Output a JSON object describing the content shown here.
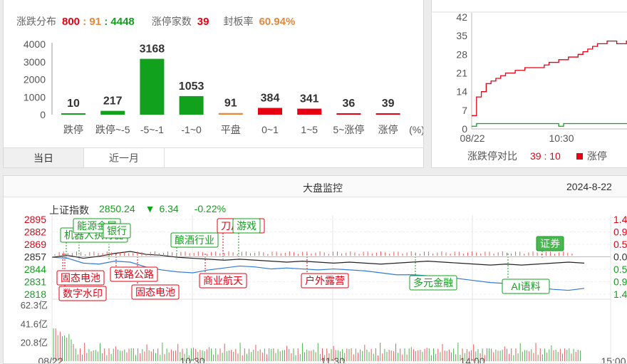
{
  "distribution": {
    "label": "涨跌分布",
    "up": "800",
    "sep1": ":",
    "flat": "91",
    "sep2": ":",
    "down": "4448",
    "limit_up_label": "涨停家数",
    "limit_up_count": "39",
    "seal_rate_label": "封板率",
    "seal_rate": "60.94%",
    "unit": "(%)",
    "tabs": [
      {
        "label": "当日"
      },
      {
        "label": "近一月"
      }
    ]
  },
  "ratio": {
    "label": "涨跌停对比",
    "value": "39 : 10",
    "legend_label": "涨停"
  },
  "monitor": {
    "title": "大盘监控",
    "date": "2024-8-22",
    "index_name": "上证指数",
    "index_value": "2850.24",
    "arrow": "▼",
    "change": "6.34",
    "pct": "-0.22%",
    "events": [
      {
        "text": "机器人执行器",
        "color": "green",
        "t": 10
      },
      {
        "text": "能源金属",
        "color": "green",
        "t": 18
      },
      {
        "text": "银行",
        "color": "green",
        "t": 30
      },
      {
        "text": "固态电池",
        "color": "red",
        "t": 8
      },
      {
        "text": "数字水印",
        "color": "red",
        "t": 4
      },
      {
        "text": "铁路公路",
        "color": "red",
        "t": 36
      },
      {
        "text": "固态电池",
        "color": "red",
        "t": 48
      },
      {
        "text": "酿酒行业",
        "color": "green",
        "t": 68
      },
      {
        "text": "商业航天",
        "color": "red",
        "t": 70
      },
      {
        "text": "刀片电池",
        "color": "red",
        "t": 80
      },
      {
        "text": "游戏",
        "color": "green",
        "t": 86
      },
      {
        "text": "户外露营",
        "color": "red",
        "t": 119
      },
      {
        "text": "多元金融",
        "color": "green",
        "t": 170
      },
      {
        "text": "AI语料",
        "color": "green",
        "t": 204
      },
      {
        "text": "证券",
        "color": "green",
        "t": 210
      }
    ]
  },
  "chart_data": [
    {
      "type": "bar",
      "categories": [
        "跌停",
        "跌停~-5",
        "-5~-1",
        "-1~0",
        "平盘",
        "0~1",
        "1~5",
        "5~涨停",
        "涨停"
      ],
      "values": [
        10,
        217,
        3168,
        1053,
        91,
        384,
        341,
        36,
        39
      ],
      "colors": [
        "#11a11c",
        "#11a11c",
        "#11a11c",
        "#11a11c",
        "#e8873a",
        "#e60012",
        "#e60012",
        "#e60012",
        "#e60012"
      ],
      "ylim": [
        0,
        4000
      ],
      "yticks": [
        "4000",
        "3000",
        "2000",
        "1000",
        "0"
      ]
    },
    {
      "type": "line",
      "x_start": "08/22",
      "x_ticks": [
        "08/22",
        "10:30"
      ],
      "yticks": [
        "42",
        "35",
        "28",
        "21",
        "14",
        "7",
        "0"
      ],
      "ylim": [
        0,
        42
      ],
      "series": [
        {
          "name": "涨停",
          "color": "#e60012",
          "values": [
            5,
            12,
            14,
            17,
            18,
            19,
            20,
            21,
            21,
            22,
            22,
            23,
            23,
            23,
            23,
            24,
            25,
            25,
            26,
            26,
            27,
            27,
            28,
            29,
            30,
            31,
            32,
            32,
            33,
            33,
            32,
            32,
            33,
            32
          ]
        },
        {
          "name": "跌停",
          "color": "#11a11c",
          "values": [
            1,
            2,
            2,
            2,
            2,
            2,
            2,
            2,
            2,
            2,
            2,
            2,
            2,
            2,
            2,
            2,
            2,
            2,
            1,
            2,
            2,
            2,
            2,
            2,
            2,
            2,
            2,
            2,
            2,
            2,
            2,
            2,
            2,
            2
          ]
        }
      ]
    },
    {
      "type": "line",
      "x_ticks": [
        "08/22",
        "10:30",
        "11:30",
        "14:00",
        "15:00"
      ],
      "y_left_ticks": [
        "2895",
        "2882",
        "2869",
        "2857",
        "2844",
        "2831",
        "2818"
      ],
      "y_right_ticks": [
        "1.4",
        "0.9",
        "0.5",
        "0.0",
        "0.5",
        "0.9",
        "1.4"
      ],
      "volume_ticks": [
        "62.3亿",
        "41.6亿",
        "20.8亿"
      ],
      "ylim": [
        2818,
        2895
      ],
      "series": [
        {
          "name": "上证指数",
          "color": "#222222",
          "values": [
            2856,
            2858,
            2855,
            2857,
            2860,
            2862,
            2859,
            2858,
            2856,
            2855,
            2854,
            2853,
            2854,
            2853,
            2852,
            2851,
            2852,
            2851,
            2850,
            2851,
            2850,
            2849,
            2850,
            2851,
            2852,
            2851,
            2850,
            2849,
            2848,
            2849,
            2848,
            2849,
            2850,
            2851,
            2850
          ]
        },
        {
          "name": "blue",
          "color": "#2f7bd1",
          "values": [
            2856,
            2855,
            2850,
            2849,
            2852,
            2851,
            2846,
            2843,
            2841,
            2840,
            2843,
            2845,
            2847,
            2846,
            2844,
            2845,
            2844,
            2843,
            2844,
            2843,
            2842,
            2840,
            2838,
            2838,
            2837,
            2836,
            2834,
            2832,
            2830,
            2829,
            2828,
            2825,
            2823,
            2822,
            2824
          ]
        }
      ]
    }
  ]
}
